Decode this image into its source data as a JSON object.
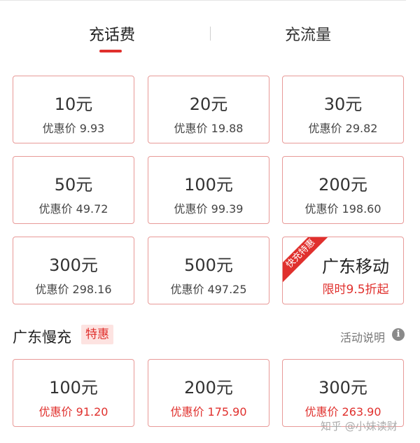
{
  "tabs": {
    "active": "充话费",
    "inactive": "充流量"
  },
  "cards": [
    {
      "amount": "10元",
      "price": "优惠价 9.93"
    },
    {
      "amount": "20元",
      "price": "优惠价 19.88"
    },
    {
      "amount": "30元",
      "price": "优惠价 29.82"
    },
    {
      "amount": "50元",
      "price": "优惠价 49.72"
    },
    {
      "amount": "100元",
      "price": "优惠价 99.39"
    },
    {
      "amount": "200元",
      "price": "优惠价 198.60"
    },
    {
      "amount": "300元",
      "price": "优惠价 298.16"
    },
    {
      "amount": "500元",
      "price": "优惠价 497.25"
    }
  ],
  "promo": {
    "ribbon": "快充特惠",
    "title": "广东移动",
    "subtitle": "限时9.5折起"
  },
  "section": {
    "title": "广东慢充",
    "badge": "特惠",
    "link": "活动说明",
    "info_icon": "i"
  },
  "slow_cards": [
    {
      "amount": "100元",
      "price": "优惠价 91.20"
    },
    {
      "amount": "200元",
      "price": "优惠价 175.90"
    },
    {
      "amount": "300元",
      "price": "优惠价 263.90"
    }
  ],
  "watermark": "知乎 @小妹读财",
  "colors": {
    "accent": "#e0302d",
    "card_border": "#e89a98",
    "badge_bg": "#fde3e1"
  }
}
